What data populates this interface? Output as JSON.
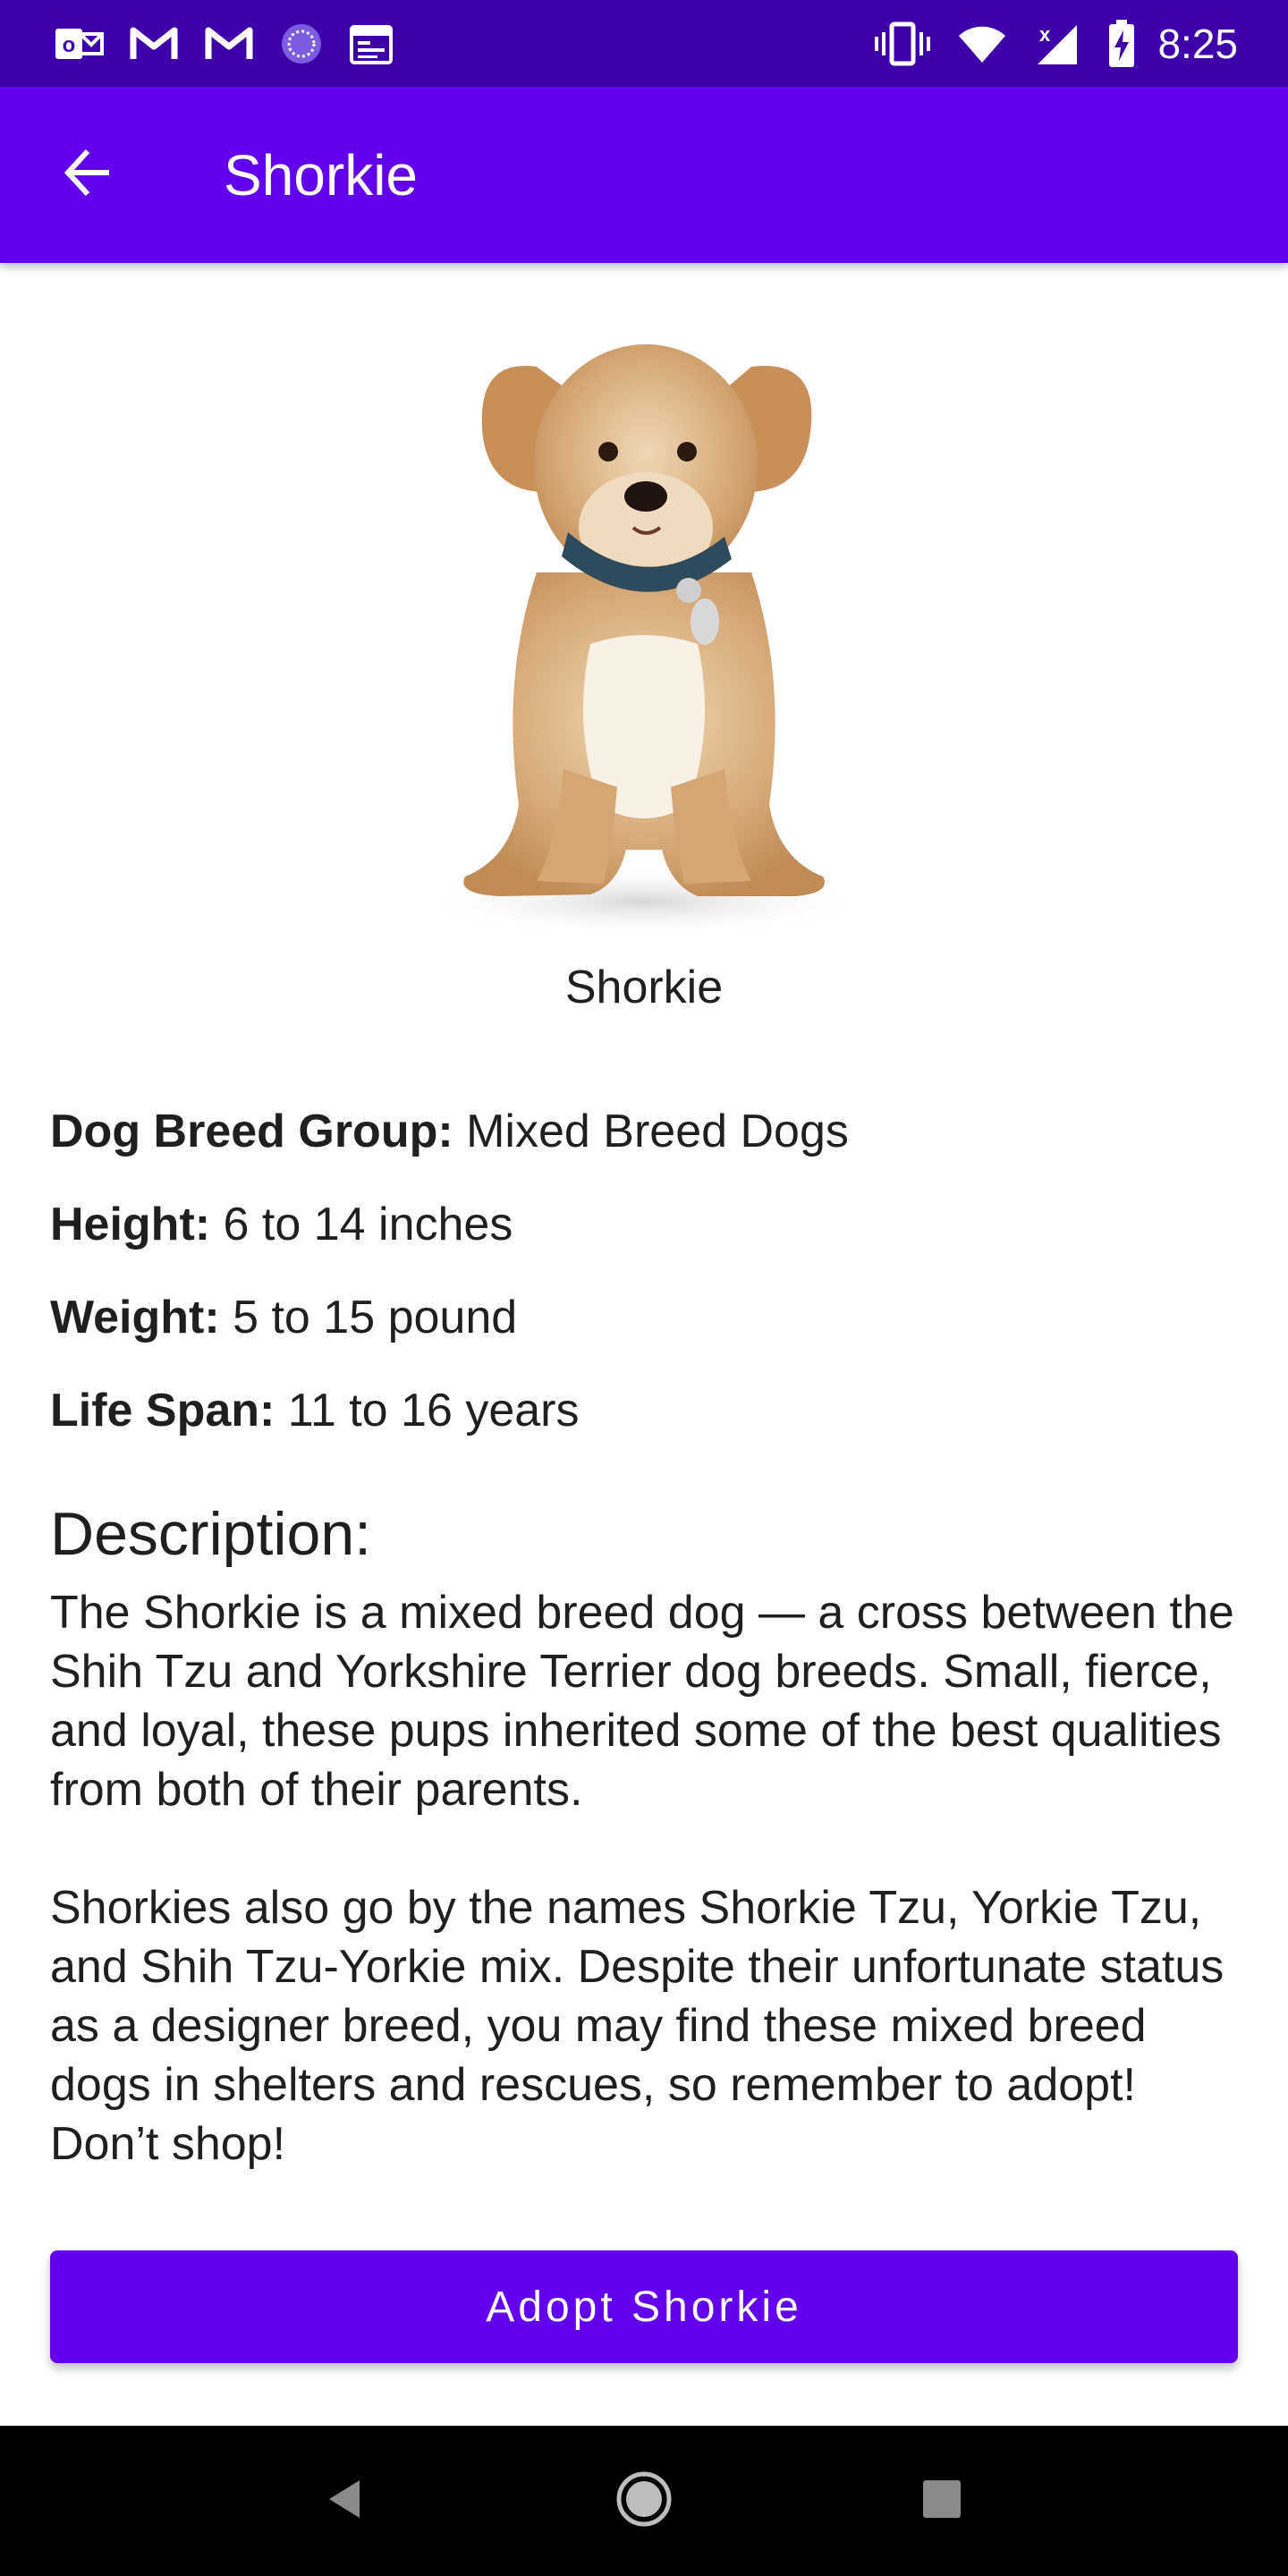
{
  "status_bar": {
    "time": "8:25",
    "left_icons": [
      "outlook-icon",
      "gmail-icon",
      "gmail-icon",
      "sync-icon",
      "calendar-icon"
    ],
    "right_icons": [
      "vibrate-icon",
      "wifi-icon",
      "signal-icon",
      "battery-charging-icon"
    ]
  },
  "app_bar": {
    "title": "Shorkie",
    "back_icon": "arrow-back-icon",
    "color": "#6200ee"
  },
  "hero": {
    "image": "shorkie-dog-photo",
    "caption": "Shorkie"
  },
  "facts": [
    {
      "label": "Dog Breed Group:",
      "value": " Mixed Breed Dogs"
    },
    {
      "label": "Height:",
      "value": " 6 to 14 inches"
    },
    {
      "label": "Weight:",
      "value": " 5 to 15 pound"
    },
    {
      "label": "Life Span:",
      "value": " 11 to 16 years"
    }
  ],
  "description": {
    "heading": "Description:",
    "paragraphs": [
      "The Shorkie is a mixed breed dog — a cross between the Shih Tzu and Yorkshire Terrier dog breeds. Small, fierce, and loyal, these pups inherited some of the best qualities from both of their parents.",
      "Shorkies also go by the names Shorkie Tzu, Yorkie Tzu, and Shih Tzu-Yorkie mix. Despite their unfortunate status as a designer breed, you may find these mixed breed dogs in shelters and rescues, so remember to adopt! Don’t shop!"
    ]
  },
  "adopt_button": {
    "label": "Adopt Shorkie"
  },
  "nav_bar": {
    "icons": [
      "back-triangle-icon",
      "home-circle-icon",
      "recents-square-icon"
    ]
  },
  "colors": {
    "status_bar": "#3e00a9",
    "primary": "#6200ee",
    "nav_bar": "#000000"
  }
}
